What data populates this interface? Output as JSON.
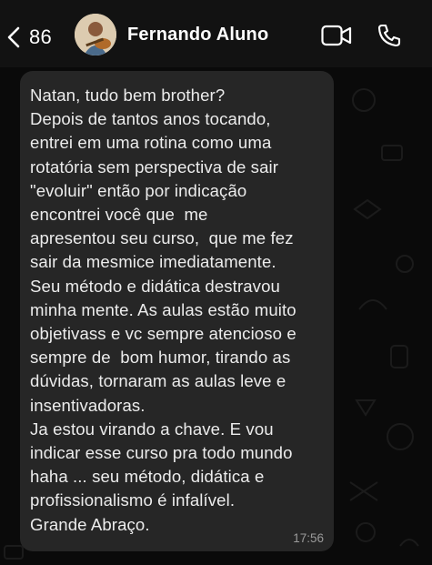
{
  "header": {
    "back_count": "86",
    "contact_name": "Fernando Aluno",
    "icons": [
      "chevron-left-icon",
      "avatar",
      "video-camera-icon",
      "phone-icon"
    ]
  },
  "message": {
    "lines": [
      "Natan, tudo bem brother?",
      "Depois de tantos anos tocando,",
      "entrei em uma rotina como uma",
      "rotatória sem perspectiva de sair",
      "\"evoluir\" então por indicação",
      "encontrei você que  me",
      "apresentou seu curso,  que me fez",
      "sair da mesmice imediatamente.",
      "Seu método e didática destravou",
      "minha mente. As aulas estão muito",
      "objetivass e vc sempre atencioso e",
      "sempre de  bom humor, tirando as",
      "dúvidas, tornaram as aulas leve e",
      "insentivadoras.",
      "Ja estou virando a chave. E vou",
      "indicar esse curso pra todo mundo",
      "haha ... seu método, didática e",
      "profissionalismo é infalível.",
      "Grande Abraço."
    ],
    "time": "17:56"
  },
  "colors": {
    "background": "#0a0a0a",
    "header": "#121212",
    "bubble": "#262626",
    "text": "#ececec",
    "timestamp": "#9a9a9a"
  }
}
